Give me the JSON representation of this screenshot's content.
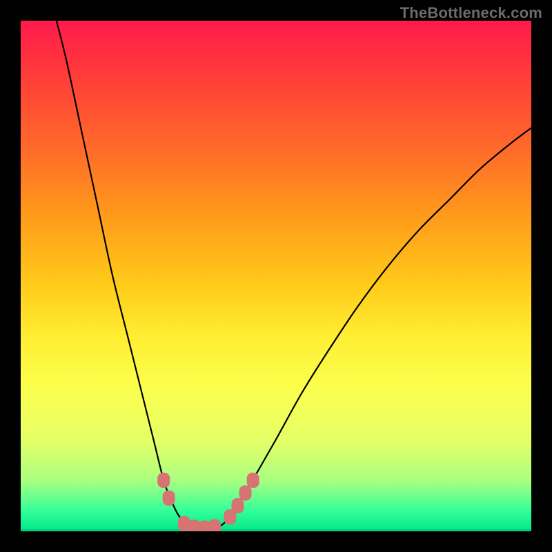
{
  "attribution": "TheBottleneck.com",
  "colors": {
    "gradient_top": "#ff1a4d",
    "gradient_bottom": "#00e68a",
    "curve": "#000000",
    "markers": "#d77373",
    "frame": "#000000"
  },
  "chart_data": {
    "type": "line",
    "title": "",
    "xlabel": "",
    "ylabel": "",
    "xlim": [
      0,
      100
    ],
    "ylim": [
      0,
      100
    ],
    "curve_points": [
      {
        "x": 7,
        "y": 100
      },
      {
        "x": 9,
        "y": 92
      },
      {
        "x": 12,
        "y": 78
      },
      {
        "x": 15,
        "y": 64
      },
      {
        "x": 18,
        "y": 50
      },
      {
        "x": 21,
        "y": 38
      },
      {
        "x": 24,
        "y": 26
      },
      {
        "x": 26,
        "y": 18
      },
      {
        "x": 28,
        "y": 10
      },
      {
        "x": 29.5,
        "y": 6
      },
      {
        "x": 31,
        "y": 3
      },
      {
        "x": 33,
        "y": 1
      },
      {
        "x": 36,
        "y": 0.5
      },
      {
        "x": 39,
        "y": 1
      },
      {
        "x": 41,
        "y": 3
      },
      {
        "x": 43,
        "y": 6
      },
      {
        "x": 46,
        "y": 11
      },
      {
        "x": 50,
        "y": 18
      },
      {
        "x": 55,
        "y": 27
      },
      {
        "x": 60,
        "y": 35
      },
      {
        "x": 66,
        "y": 44
      },
      {
        "x": 72,
        "y": 52
      },
      {
        "x": 78,
        "y": 59
      },
      {
        "x": 84,
        "y": 65
      },
      {
        "x": 90,
        "y": 71
      },
      {
        "x": 96,
        "y": 76
      },
      {
        "x": 100,
        "y": 79
      }
    ],
    "markers": [
      {
        "x": 28,
        "y": 10
      },
      {
        "x": 29,
        "y": 6.5
      },
      {
        "x": 32,
        "y": 1.5
      },
      {
        "x": 34,
        "y": 0.8
      },
      {
        "x": 36,
        "y": 0.6
      },
      {
        "x": 38,
        "y": 0.9
      },
      {
        "x": 41,
        "y": 2.8
      },
      {
        "x": 42.5,
        "y": 5
      },
      {
        "x": 44,
        "y": 7.5
      },
      {
        "x": 45.5,
        "y": 10
      }
    ]
  }
}
